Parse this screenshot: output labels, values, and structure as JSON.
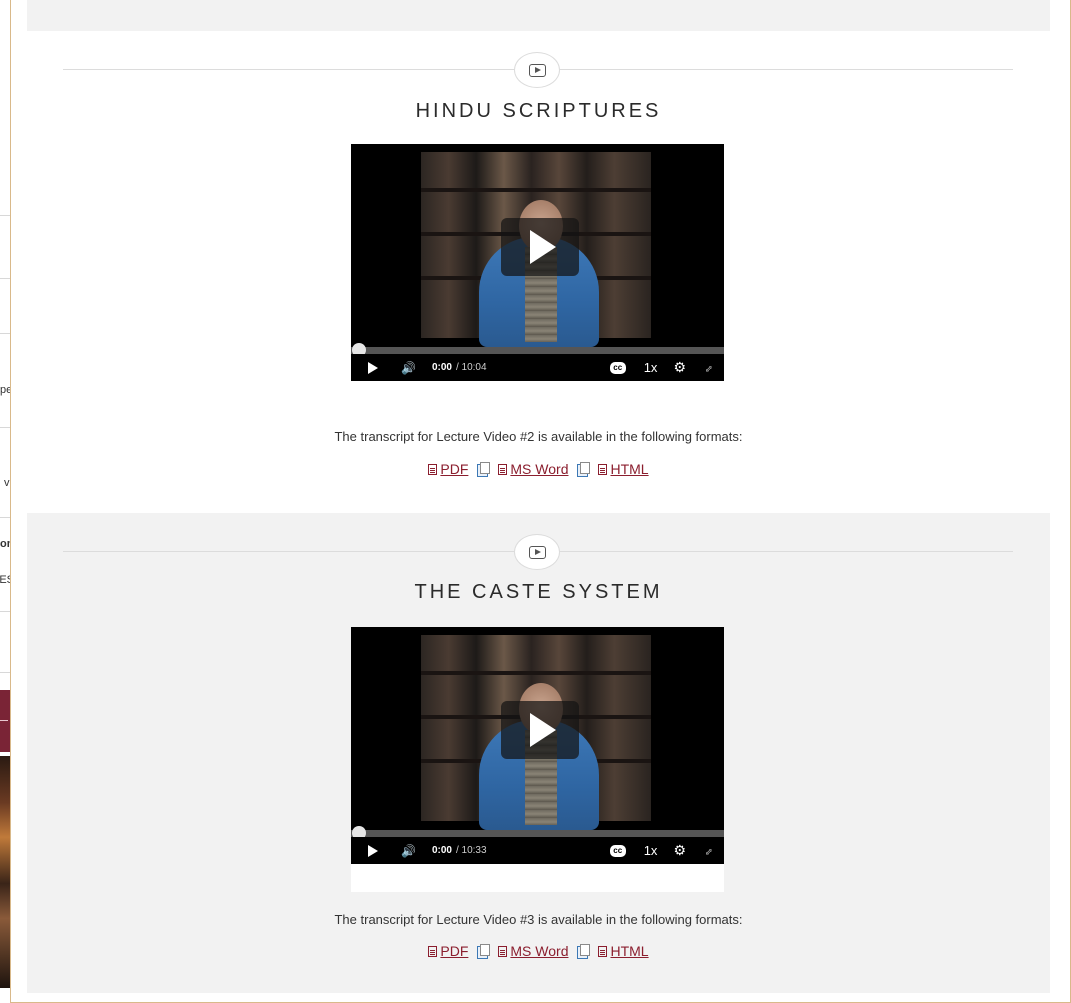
{
  "background_page": {
    "snippets": [
      "pe",
      "v",
      "on",
      "ES"
    ],
    "colors": {
      "banner": "#7a2436"
    }
  },
  "sections": [
    {
      "title": "HINDU SCRIPTURES",
      "player": {
        "current_time": "0:00",
        "duration": "/ 10:04",
        "captions_label": "cc",
        "speed_label": "1x",
        "progress": 0
      },
      "transcript_text": "The transcript for Lecture Video #2 is available in the following formats:",
      "links": [
        "PDF",
        "MS Word",
        "HTML"
      ]
    },
    {
      "title": "THE CASTE SYSTEM",
      "player": {
        "current_time": "0:00",
        "duration": "/ 10:33",
        "captions_label": "cc",
        "speed_label": "1x",
        "progress": 0
      },
      "transcript_text": "The transcript for Lecture Video #3 is available in the following formats:",
      "links": [
        "PDF",
        "MS Word",
        "HTML"
      ]
    }
  ],
  "colors": {
    "link": "#8b1e2e",
    "frame_border": "#d9b98a",
    "section_alt_bg": "#f2f2f2"
  },
  "icons": {
    "section_badge": "video-play-icon",
    "file": "document-icon",
    "copy": "copy-icon",
    "gear": "gear-icon",
    "fullscreen": "fullscreen-icon",
    "volume": "volume-icon"
  }
}
